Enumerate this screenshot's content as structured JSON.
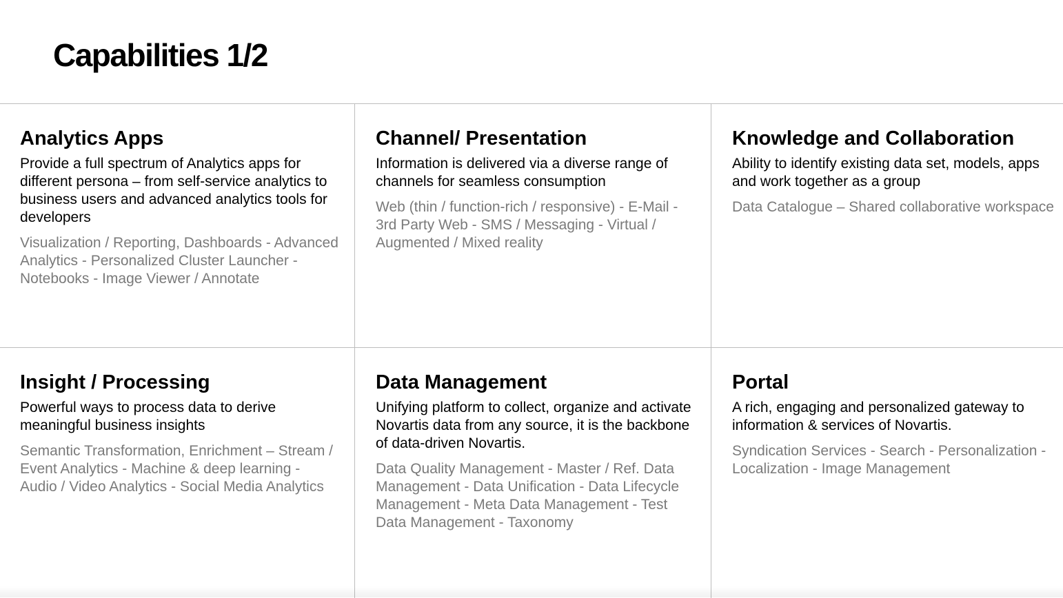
{
  "title": "Capabilities 1/2",
  "capabilities": [
    {
      "title": "Analytics Apps",
      "description": "Provide a full spectrum of Analytics apps for different persona  – from self-service analytics to business users and advanced analytics tools for developers",
      "items": "Visualization / Reporting, Dashboards - Advanced Analytics - Personalized Cluster Launcher - Notebooks - Image Viewer / Annotate"
    },
    {
      "title": "Channel/ Presentation",
      "description": "Information is delivered via a diverse range of channels for seamless consumption",
      "items": "Web (thin / function-rich / responsive) - E-Mail - 3rd Party Web - SMS / Messaging - Virtual / Augmented / Mixed reality"
    },
    {
      "title": "Knowledge and Collaboration",
      "description": "Ability to identify existing data set, models, apps and work together as a group",
      "items": "Data Catalogue – Shared collaborative workspace"
    },
    {
      "title": "Insight / Processing",
      "description": "Powerful ways to process data to derive meaningful business insights",
      "items": "Semantic Transformation, Enrichment – Stream / Event Analytics -  Machine & deep learning - Audio / Video Analytics - Social Media Analytics"
    },
    {
      "title": "Data Management",
      "description": "Unifying platform to collect, organize and activate Novartis data from any source, it is the backbone of data-driven Novartis.",
      "items": "Data Quality Management - Master / Ref. Data Management - Data Unification - Data Lifecycle Management - Meta Data Management - Test Data Management - Taxonomy"
    },
    {
      "title": "Portal",
      "description": "A rich, engaging and personalized gateway to information & services of Novartis.",
      "items": "Syndication Services - Search - Personalization - Localization - Image Management"
    }
  ]
}
